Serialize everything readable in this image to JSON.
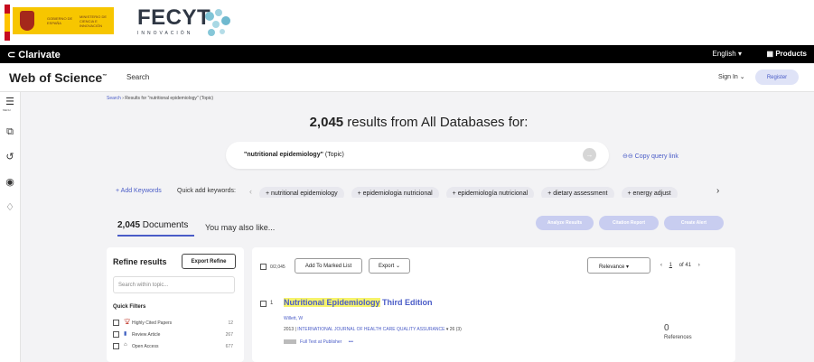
{
  "banner": {
    "gov_text": "GOBIERNO DE ESPAÑA",
    "ministry_text": "MINISTERIO DE CIENCIA E INNOVACIÓN",
    "fecyt_name": "FECYT",
    "fecyt_sub": "INNOVACIÓN"
  },
  "clarivate": {
    "logo": "Clarivate",
    "language": "English ▾",
    "products": "▦ Products"
  },
  "header": {
    "title": "Web of Science",
    "search_label": "Search",
    "signin": "Sign In ⌄",
    "register": "Register"
  },
  "rail": {
    "menu_label": "MENU"
  },
  "breadcrumb": {
    "root": "Search",
    "separator": "›",
    "current": "Results for \"nutritional epidemiology\" (Topic)"
  },
  "headline": {
    "count": "2,045",
    "text": " results from All Databases for:"
  },
  "query": {
    "term": "\"nutritional epidemiology\"",
    "field": " (Topic)",
    "copy_link": "⊖⊖ Copy query link"
  },
  "keywords": {
    "add_label": "+ Add Keywords",
    "quick_label": "Quick add keywords:",
    "chips": [
      "+ nutritional epidemiology",
      "+ epidemiologia nutricional",
      "+ epidemiología nutricional",
      "+ dietary assessment",
      "+ energy adjust"
    ]
  },
  "tabs": {
    "docs_count": "2,045",
    "docs_label": " Documents",
    "also": "You may also like..."
  },
  "actions": {
    "analyze": "Analyze Results",
    "citation": "Citation Report",
    "alert": "Create Alert"
  },
  "refine": {
    "title": "Refine results",
    "export": "Export Refine",
    "search_placeholder": "Search within topic...",
    "quick_filters_title": "Quick Filters",
    "filters": [
      {
        "label": "Highly Cited Papers",
        "count": "12",
        "icon": "trophy-icon"
      },
      {
        "label": "Review Article",
        "count": "267",
        "icon": "document-icon"
      },
      {
        "label": "Open Access",
        "count": "677",
        "icon": "open-lock-icon"
      }
    ]
  },
  "results": {
    "selected": "0/2,045",
    "add_marked": "Add To Marked List",
    "export": "Export ⌄",
    "sort": "Relevance ▾",
    "page": "1",
    "of_pages": "of 41",
    "record": {
      "number": "1",
      "title_highlight": "Nutritional Epidemiology",
      "title_rest": " Third Edition",
      "author": "Willett, W",
      "year": "2013 |",
      "journal": " INTERNATIONAL JOURNAL OF HEALTH CARE QUALITY ASSURANCE",
      "volume": " 26 (3)",
      "full_text": "Full Text at Publisher",
      "more": "•••",
      "references_count": "0",
      "references_label": "References"
    }
  }
}
